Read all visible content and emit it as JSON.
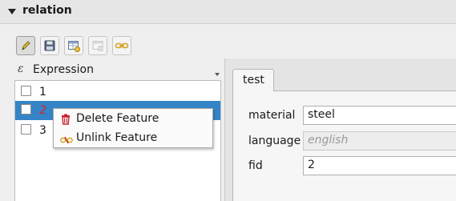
{
  "section": {
    "title": "relation"
  },
  "toolbar": {
    "buttons": [
      {
        "name": "toggle-editing-button",
        "icon": "pencil-icon"
      },
      {
        "name": "save-edits-button",
        "icon": "save-icon"
      },
      {
        "name": "add-feature-button",
        "icon": "add-feature-icon"
      },
      {
        "name": "delete-feature-button",
        "icon": "delete-feature-icon"
      },
      {
        "name": "unlink-feature-button",
        "icon": "link-icon"
      }
    ]
  },
  "display_expression": {
    "icon": "ε",
    "label": "Expression"
  },
  "feature_list": {
    "items": [
      {
        "label": "1",
        "checked": false,
        "selected": false
      },
      {
        "label": "2",
        "checked": false,
        "selected": true
      },
      {
        "label": "3",
        "checked": false,
        "selected": false
      }
    ]
  },
  "context_menu": {
    "items": [
      {
        "label": "Delete Feature",
        "icon": "trash-icon"
      },
      {
        "label": "Unlink Feature",
        "icon": "unlink-icon"
      }
    ]
  },
  "form": {
    "tab": "test",
    "fields": [
      {
        "label": "material",
        "value": "steel",
        "editable": true
      },
      {
        "label": "language",
        "value": "english",
        "editable": false
      },
      {
        "label": "fid",
        "value": "2",
        "editable": true
      }
    ]
  },
  "colors": {
    "selection": "#3584c7",
    "selected_text": "#d9232a"
  }
}
